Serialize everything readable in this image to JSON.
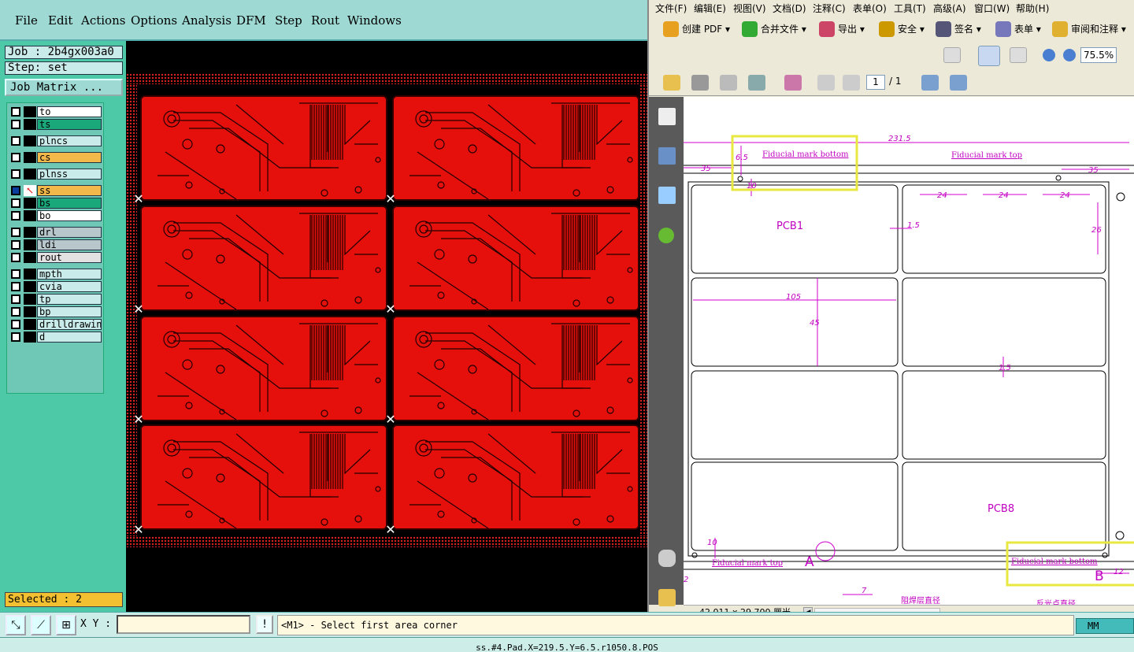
{
  "cam": {
    "menu": [
      "File",
      "Edit",
      "Actions",
      "Options",
      "Analysis",
      "DFM",
      "Step",
      "Rout",
      "Windows"
    ],
    "job_label": "Job : 2b4gx003a0",
    "step_label": "Step: set",
    "job_matrix_btn": "Job Matrix ...",
    "layers": [
      {
        "name": "to",
        "color": "#ffffff"
      },
      {
        "name": "ts",
        "color": "#1aa77a"
      },
      {
        "name": "plncs",
        "color": "#c9ecea"
      },
      {
        "name": "cs",
        "color": "#f2b84a"
      },
      {
        "name": "plnss",
        "color": "#c9ecea"
      },
      {
        "name": "ss",
        "color": "#f2b84a"
      },
      {
        "name": "bs",
        "color": "#1aa77a"
      },
      {
        "name": "bo",
        "color": "#ffffff"
      },
      {
        "name": "drl",
        "color": "#b8c7cc"
      },
      {
        "name": "ldi",
        "color": "#b8c7cc"
      },
      {
        "name": "rout",
        "color": "#e2e2e2"
      },
      {
        "name": "mpth",
        "color": "#c9ecea"
      },
      {
        "name": "cvia",
        "color": "#c9ecea"
      },
      {
        "name": "tp",
        "color": "#c9ecea"
      },
      {
        "name": "bp",
        "color": "#c9ecea"
      },
      {
        "name": "drilldrawing",
        "color": "#c9ecea"
      },
      {
        "name": "d",
        "color": "#c9ecea"
      }
    ],
    "selected_text": "Selected : 2",
    "xy_label": "X Y :",
    "bang": "!",
    "prompt_text": "<M1> - Select first area corner",
    "mm_btn": "MM",
    "status_text": "ss.#4.Pad.X=219.5.Y=6.5.r1050.8.POS",
    "board_color": "#e5100c"
  },
  "pdf": {
    "menu": [
      "文件(F)",
      "编辑(E)",
      "视图(V)",
      "文档(D)",
      "注释(C)",
      "表单(O)",
      "工具(T)",
      "高级(A)",
      "窗口(W)",
      "帮助(H)"
    ],
    "toolbar": [
      "创建 PDF ▾",
      "合并文件 ▾",
      "导出 ▾",
      "安全 ▾",
      "签名 ▾",
      "表单 ▾",
      "审阅和注释 ▾"
    ],
    "zoom": "75.5%",
    "page_current": "1",
    "page_total": "/ 1",
    "page_size": "42.011 x 29.700 厘米",
    "drawing": {
      "dim_total": "231.5",
      "dim_35_left": "35",
      "dim_35_right": "35",
      "dim_65": "6.5",
      "dim_10": "10",
      "dim_24a": "24",
      "dim_24b": "24",
      "dim_24c": "24",
      "dim_15": "1.5",
      "dim_26": "26",
      "dim_105": "105",
      "dim_45": "45",
      "dim_15b": "1.5",
      "dim_10b": "10",
      "dim_7": "7",
      "dim_12": "12",
      "dim_2": "2",
      "fid_bottom_1": "Fiducial mark bottom",
      "fid_top_1": "Fiducial mark top",
      "fid_top_2": "Fiducial mark top",
      "fid_bottom_2": "Fiducial mark bottom",
      "pcb1": "PCB1",
      "pcb8": "PCB8",
      "mark_a": "A",
      "mark_b": "B",
      "note1": "阻焊层直径",
      "note2": "反光点直径"
    }
  }
}
